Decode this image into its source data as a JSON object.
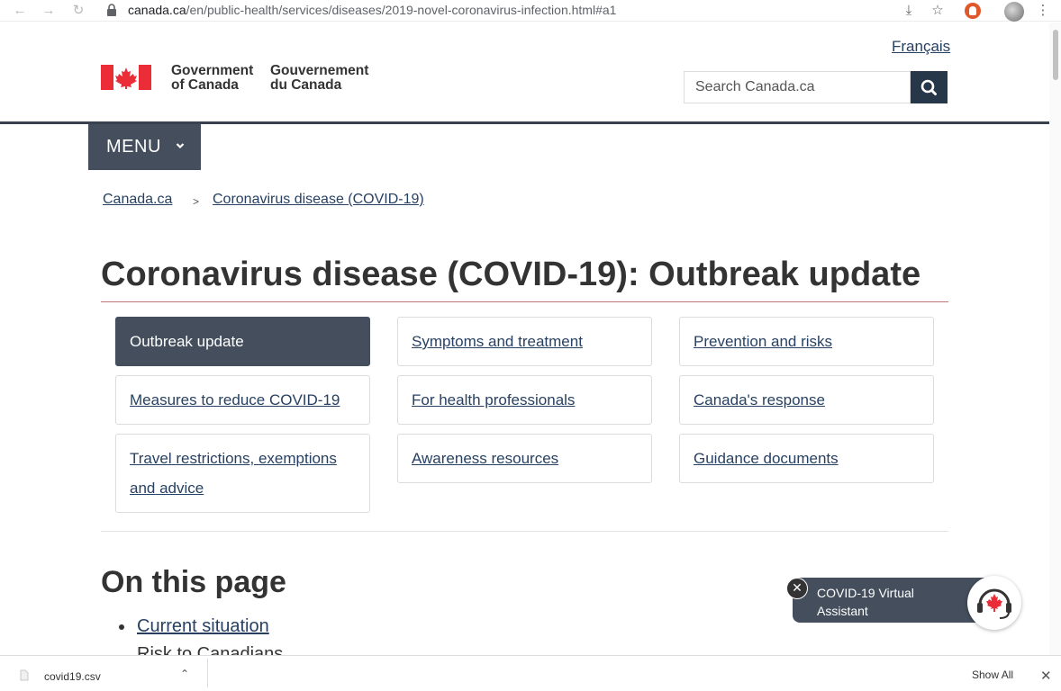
{
  "browser": {
    "url_host": "canada.ca",
    "url_path": "/en/public-health/services/diseases/2019-novel-coronavirus-infection.html#a1"
  },
  "header": {
    "lang_link": "Français",
    "gov_en_line1": "Government",
    "gov_en_line2": "of Canada",
    "gov_fr_line1": "Gouvernement",
    "gov_fr_line2": "du Canada",
    "search_placeholder": "Search Canada.ca",
    "menu_label": "MENU"
  },
  "breadcrumb": {
    "items": [
      "Canada.ca",
      "Coronavirus disease (COVID-19)"
    ],
    "separator": ">"
  },
  "page": {
    "title": "Coronavirus disease (COVID-19): Outbreak update",
    "nav_items": [
      "Outbreak update",
      "Symptoms and treatment",
      "Prevention and risks",
      "Measures to reduce COVID-19",
      "For health professionals",
      "Canada's response",
      "Travel restrictions, exemptions and advice",
      "Awareness resources",
      "Guidance documents"
    ],
    "on_this_page": "On this page",
    "toc": [
      "Current situation",
      "Risk to Canadians"
    ]
  },
  "assistant": {
    "label_line1": "COVID-19 Virtual",
    "label_line2": "Assistant",
    "close_glyph": "✕"
  },
  "downloads": {
    "file_name": "covid19.csv",
    "show_all": "Show All"
  },
  "colors": {
    "gov_dark": "#26374a",
    "menu_bg": "#444e5c",
    "link": "#284162",
    "flag_red": "#eb2d37"
  }
}
